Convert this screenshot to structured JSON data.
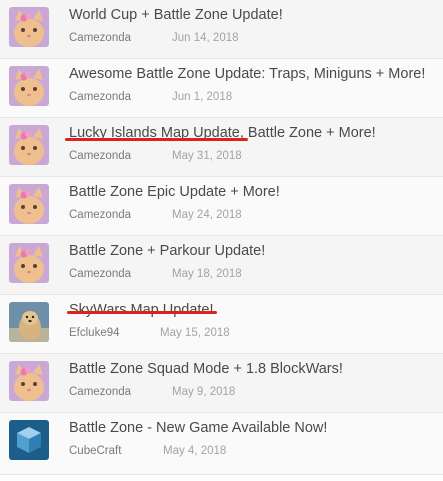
{
  "threads": [
    {
      "title": "World Cup + Battle Zone Update!",
      "author": "Camezonda",
      "date": "Jun 14, 2018",
      "avatar": "cat-avatar"
    },
    {
      "title": "Awesome Battle Zone Update: Traps, Miniguns + More!",
      "author": "Camezonda",
      "date": "Jun 1, 2018",
      "avatar": "cat-avatar"
    },
    {
      "title": "Lucky Islands Map Update, Battle Zone + More!",
      "author": "Camezonda",
      "date": "May 31, 2018",
      "avatar": "cat-avatar",
      "struck": "Lucky Islands Map Update"
    },
    {
      "title": "Battle Zone Epic Update + More!",
      "author": "Camezonda",
      "date": "May 24, 2018",
      "avatar": "cat-avatar"
    },
    {
      "title": "Battle Zone + Parkour Update!",
      "author": "Camezonda",
      "date": "May 18, 2018",
      "avatar": "cat-avatar"
    },
    {
      "title": "SkyWars Map Update!",
      "author": "Efcluke94",
      "date": "May 15, 2018",
      "avatar": "dog-avatar",
      "struck": "SkyWars Map Update!"
    },
    {
      "title": "Battle Zone Squad Mode + 1.8 BlockWars!",
      "author": "Camezonda",
      "date": "May 9, 2018",
      "avatar": "cat-avatar"
    },
    {
      "title": "Battle Zone - New Game Available Now!",
      "author": "CubeCraft",
      "date": "May 4, 2018",
      "avatar": "cubecraft-logo-avatar"
    }
  ],
  "colors": {
    "strike": "#e0201b",
    "title": "#4a4a4a",
    "author": "#7a7a7a",
    "date": "#a3a3a3"
  }
}
